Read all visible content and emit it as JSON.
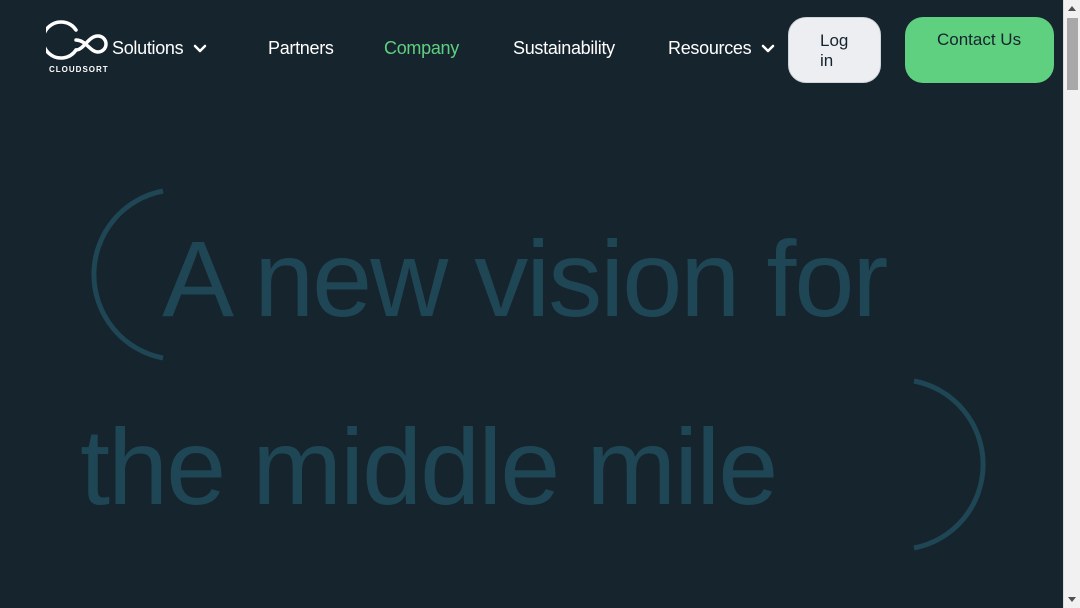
{
  "brand": {
    "name": "CLOUDSORT",
    "logo_icon": "cloudsort-logo-icon"
  },
  "nav": {
    "items": [
      {
        "label": "Solutions",
        "has_dropdown": true,
        "active": false
      },
      {
        "label": "Partners",
        "has_dropdown": false,
        "active": false
      },
      {
        "label": "Company",
        "has_dropdown": false,
        "active": true
      },
      {
        "label": "Sustainability",
        "has_dropdown": false,
        "active": false
      },
      {
        "label": "Resources",
        "has_dropdown": true,
        "active": false
      }
    ],
    "login_label": "Log in",
    "contact_label": "Contact Us"
  },
  "hero": {
    "line1": "A new vision for",
    "line2": "the middle mile"
  },
  "colors": {
    "background": "#16242e",
    "accent": "#5fcf80",
    "hero_text": "#1f4654",
    "login_bg": "#eceef2"
  }
}
